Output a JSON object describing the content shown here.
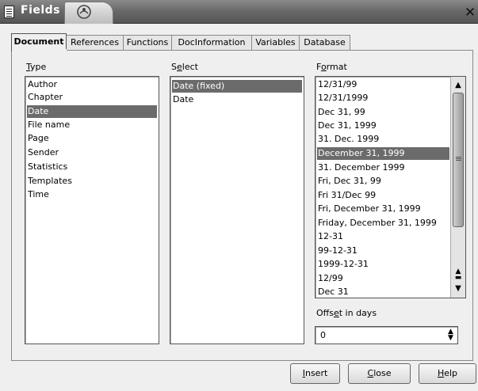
{
  "window": {
    "title": "Fields",
    "close_glyph": "✕"
  },
  "tabs": [
    {
      "label": "Document",
      "active": true
    },
    {
      "label": "References",
      "active": false
    },
    {
      "label": "Functions",
      "active": false
    },
    {
      "label": "DocInformation",
      "active": false
    },
    {
      "label": "Variables",
      "active": false
    },
    {
      "label": "Database",
      "active": false
    }
  ],
  "type_section": {
    "label_first": "T",
    "label_rest": "ype",
    "items": [
      "Author",
      "Chapter",
      "Date",
      "File name",
      "Page",
      "Sender",
      "Statistics",
      "Templates",
      "Time"
    ],
    "selected": "Date"
  },
  "select_section": {
    "label_first": "S",
    "label_underline": "e",
    "label_rest": "lect",
    "items": [
      "Date (fixed)",
      "Date"
    ],
    "selected": "Date (fixed)"
  },
  "format_section": {
    "label_first": "F",
    "label_underline": "o",
    "label_rest": "rmat",
    "items": [
      "12/31/99",
      "12/31/1999",
      "Dec 31, 99",
      "Dec 31, 1999",
      "31. Dec. 1999",
      "December 31, 1999",
      "31. December 1999",
      "Fri, Dec 31, 99",
      "Fri 31/Dec 99",
      "Fri, December 31, 1999",
      "Friday, December 31, 1999",
      "12-31",
      "99-12-31",
      "1999-12-31",
      "12/99",
      "Dec 31"
    ],
    "selected": "December 31, 1999"
  },
  "offset": {
    "label_first": "Offs",
    "label_underline": "e",
    "label_rest": "t in days",
    "value": "0"
  },
  "buttons": {
    "insert": {
      "u": "I",
      "rest": "nsert"
    },
    "close": {
      "u": "C",
      "rest": "lose"
    },
    "help": {
      "u": "H",
      "rest": "elp"
    }
  },
  "colors": {
    "selection": "#6b6b6b",
    "titlebar": "#6a6a6a"
  },
  "icons": {
    "title": "document-icon",
    "logo": "openoffice-logo-icon",
    "scroll_up": "scroll-up-arrow-icon",
    "scroll_down": "scroll-down-arrow-icon",
    "spin": "spin-updown-icon"
  }
}
